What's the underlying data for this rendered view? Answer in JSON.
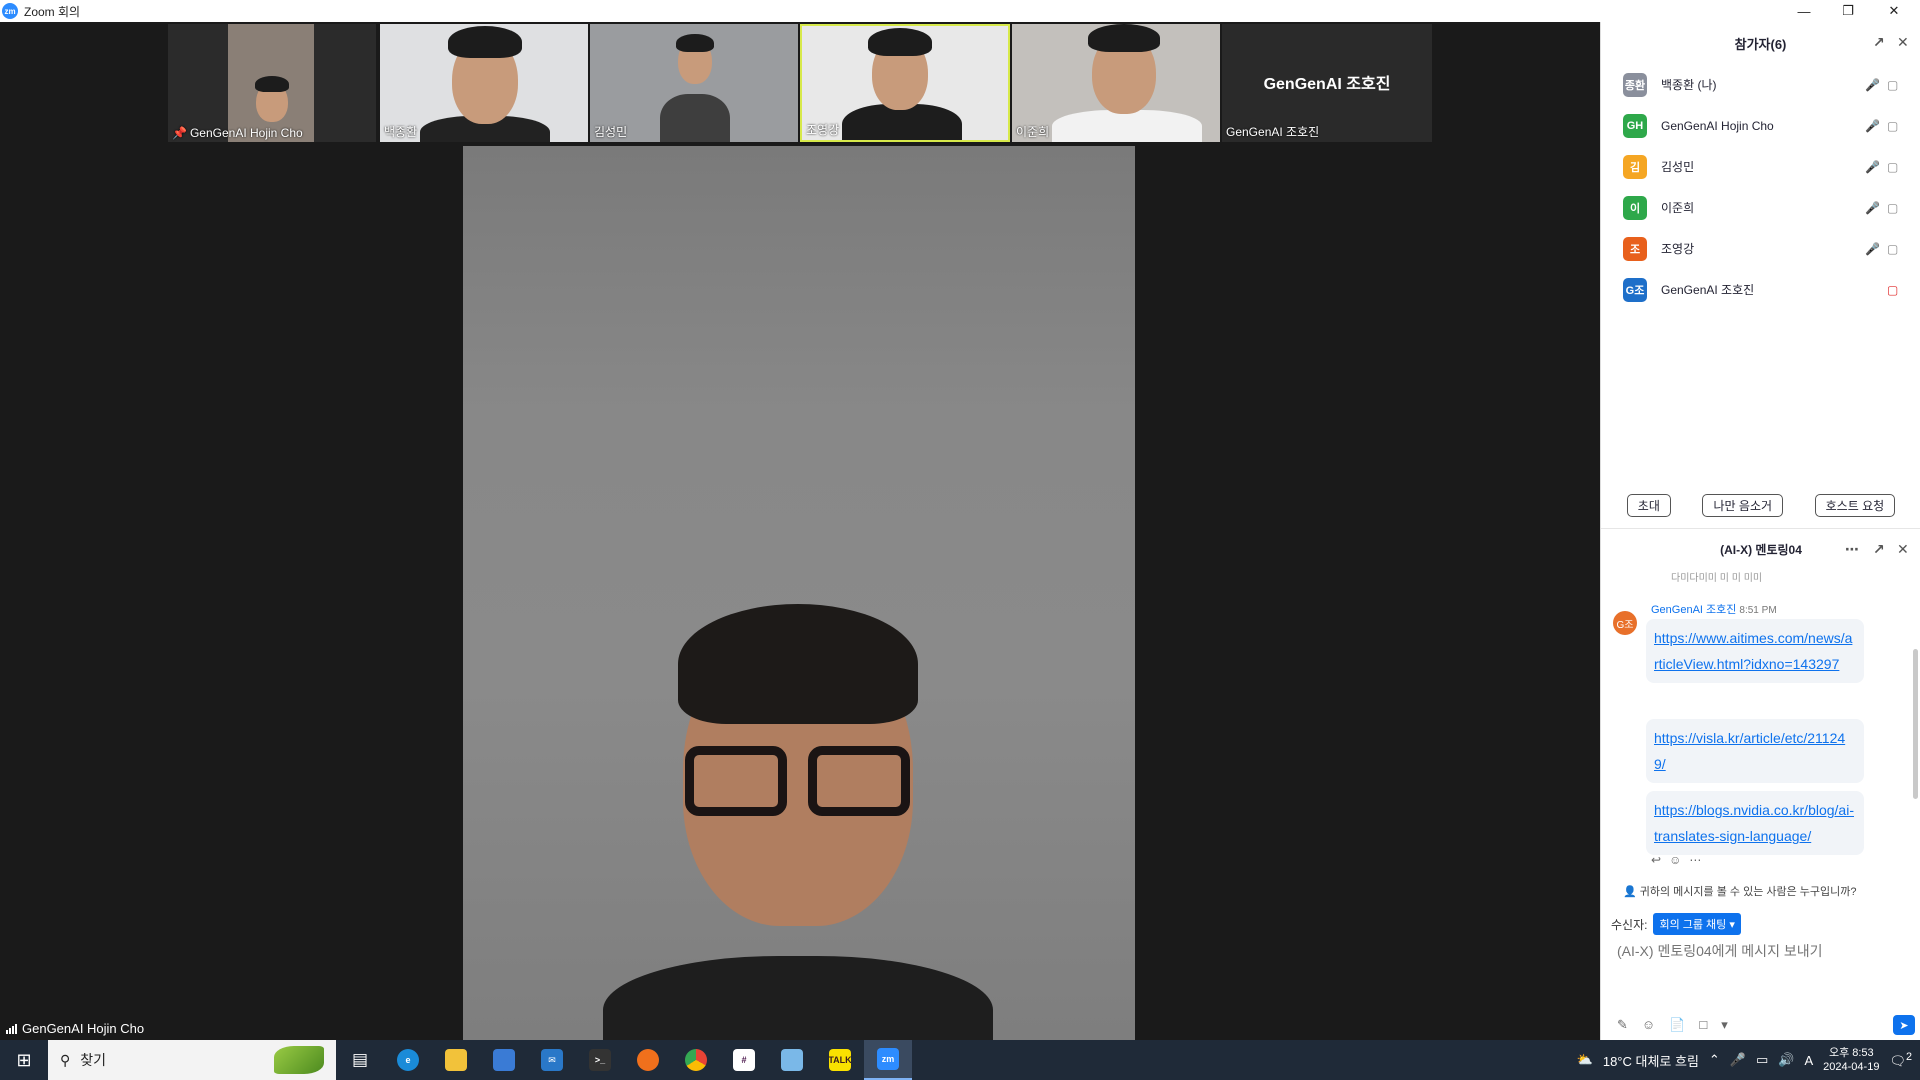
{
  "window": {
    "logo": "zm",
    "title": "Zoom 회의",
    "controls": [
      "minimize-icon",
      "restore-icon",
      "close-icon"
    ]
  },
  "thumbnails": [
    {
      "name": "GenGenAI Hojin Cho",
      "pinned": true
    },
    {
      "name": "백종환"
    },
    {
      "name": "김성민"
    },
    {
      "name": "조영강",
      "active": true
    },
    {
      "name": "이준희"
    },
    {
      "name": "GenGenAI 조호진",
      "display_name": "GenGenAI 조호진"
    }
  ],
  "speaker": {
    "name": "GenGenAI Hojin Cho"
  },
  "participants": {
    "title": "참가자(6)",
    "list": [
      {
        "initials": "종환",
        "name": "백종환 (나)",
        "color": "#8a8f9c",
        "cam_off": false
      },
      {
        "initials": "GH",
        "name": "GenGenAI Hojin Cho",
        "color": "#2ea84a",
        "cam_off": false
      },
      {
        "initials": "김",
        "name": "김성민",
        "color": "#f5a623",
        "cam_off": false
      },
      {
        "initials": "이",
        "name": "이준희",
        "color": "#2ea84a",
        "cam_off": false
      },
      {
        "initials": "조",
        "name": "조영강",
        "color": "#e8601c",
        "cam_off": false
      },
      {
        "initials": "G조",
        "name": "GenGenAI 조호진",
        "color": "#1e6fc9",
        "cam_off": true
      }
    ],
    "buttons": {
      "invite": "초대",
      "mute_me": "나만 음소거",
      "host_request": "호스트 요청"
    }
  },
  "chat": {
    "title": "(AI-X) 멘토링04",
    "cut_text": "다미다미미 미 미 미미",
    "sender": {
      "initials": "G조",
      "name": "GenGenAI 조호진",
      "time": "8:51 PM"
    },
    "messages": [
      "https://www.aitimes.com/news/articleView.html?idxno=143297",
      "https://visla.kr/article/etc/211249/",
      "https://blogs.nvidia.co.kr/blog/ai-translates-sign-language/"
    ],
    "who_can_see": "귀하의 메시지를 볼 수 있는 사람은 누구입니까?",
    "recipient_label": "수신자:",
    "recipient_value": "회의 그룹 채팅",
    "input_placeholder": "(AI-X) 멘토링04에게 메시지 보내기"
  },
  "taskbar": {
    "search_text": "찾기",
    "weather": "18°C  대체로 흐림",
    "ime": "A",
    "clock_time": "오후 8:53",
    "clock_date": "2024-04-19",
    "notif_count": "2",
    "apps": [
      {
        "icon": "task-view-icon"
      },
      {
        "icon": "edge-icon"
      },
      {
        "icon": "file-explorer-icon"
      },
      {
        "icon": "store-icon"
      },
      {
        "icon": "mail-icon"
      },
      {
        "icon": "terminal-icon"
      },
      {
        "icon": "photos-icon"
      },
      {
        "icon": "chrome-icon"
      },
      {
        "icon": "slack-icon"
      },
      {
        "icon": "notepad-icon"
      },
      {
        "icon": "kakaotalk-icon",
        "label": "TALK"
      },
      {
        "icon": "zoom-icon",
        "label": "zm",
        "active": true
      }
    ]
  }
}
